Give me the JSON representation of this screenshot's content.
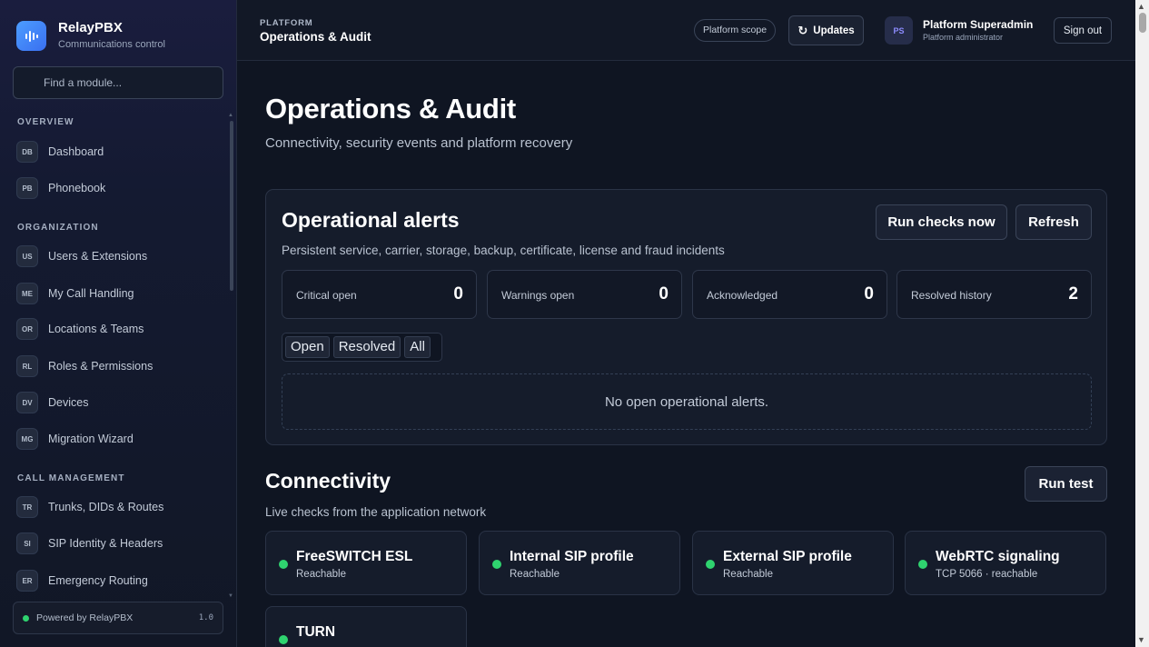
{
  "brand": {
    "name": "RelayPBX",
    "subtitle": "Communications control"
  },
  "sidebar": {
    "search_placeholder": "Find a module...",
    "sections": [
      {
        "title": "OVERVIEW",
        "items": [
          {
            "badge": "DB",
            "label": "Dashboard"
          },
          {
            "badge": "PB",
            "label": "Phonebook"
          }
        ]
      },
      {
        "title": "ORGANIZATION",
        "items": [
          {
            "badge": "US",
            "label": "Users & Extensions"
          },
          {
            "badge": "ME",
            "label": "My Call Handling"
          },
          {
            "badge": "OR",
            "label": "Locations & Teams"
          },
          {
            "badge": "RL",
            "label": "Roles & Permissions"
          },
          {
            "badge": "DV",
            "label": "Devices"
          },
          {
            "badge": "MG",
            "label": "Migration Wizard"
          }
        ]
      },
      {
        "title": "CALL MANAGEMENT",
        "items": [
          {
            "badge": "TR",
            "label": "Trunks, DIDs & Routes"
          },
          {
            "badge": "SI",
            "label": "SIP Identity & Headers"
          },
          {
            "badge": "ER",
            "label": "Emergency Routing"
          }
        ]
      }
    ],
    "footer": {
      "label": "Powered by RelayPBX",
      "version": "1.0"
    }
  },
  "topbar": {
    "eyebrow": "PLATFORM",
    "title": "Operations & Audit",
    "scope": "Platform scope",
    "updates": "Updates",
    "user": {
      "initials": "PS",
      "name": "Platform Superadmin",
      "role": "Platform administrator"
    },
    "signout": "Sign out"
  },
  "page": {
    "title": "Operations & Audit",
    "subtitle": "Connectivity, security events and platform recovery"
  },
  "alerts": {
    "title": "Operational alerts",
    "description": "Persistent service, carrier, storage, backup, certificate, license and fraud incidents",
    "run_checks": "Run checks now",
    "refresh": "Refresh",
    "stats": [
      {
        "label": "Critical open",
        "value": "0"
      },
      {
        "label": "Warnings open",
        "value": "0"
      },
      {
        "label": "Acknowledged",
        "value": "0"
      },
      {
        "label": "Resolved history",
        "value": "2"
      }
    ],
    "filters": [
      "Open",
      "Resolved",
      "All"
    ],
    "empty": "No open operational alerts."
  },
  "connectivity": {
    "title": "Connectivity",
    "description": "Live checks from the application network",
    "run_test": "Run test",
    "checks": [
      {
        "name": "FreeSWITCH ESL",
        "status": "Reachable"
      },
      {
        "name": "Internal SIP profile",
        "status": "Reachable"
      },
      {
        "name": "External SIP profile",
        "status": "Reachable"
      },
      {
        "name": "WebRTC signaling",
        "status": "TCP 5066 · reachable"
      },
      {
        "name": "TURN",
        "status": ""
      }
    ]
  },
  "colors": {
    "accent": "#3a7bf5",
    "ok": "#2fd36f",
    "bg": "#0f1522"
  }
}
